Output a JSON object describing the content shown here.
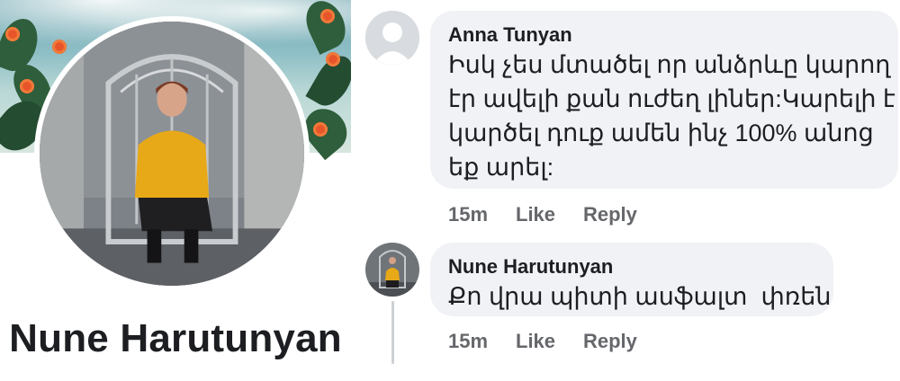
{
  "profile": {
    "name": "Nune Harutunyan"
  },
  "comments": [
    {
      "author": "Anna Tunyan",
      "text_lines": [
        "Իսկ չես մտածել որ անձրևը կարող",
        "էր ավելի քան ուժեղ լիներ:Կարելի է",
        "կարծել դուք ամեն ինչ 100% անոց",
        "եք արել:"
      ],
      "time": "15m",
      "like_label": "Like",
      "reply_label": "Reply",
      "avatar_icon": "default-avatar-icon"
    },
    {
      "author": "Nune Harutunyan",
      "text_lines": [
        "Քո վրա պիտի ասֆալտ  փռեն"
      ],
      "time": "15m",
      "like_label": "Like",
      "reply_label": "Reply",
      "avatar_icon": "profile-photo"
    }
  ],
  "colors": {
    "bubble": "#f0f2f5",
    "meta_text": "#65676b",
    "name_text": "#1c1e21"
  }
}
